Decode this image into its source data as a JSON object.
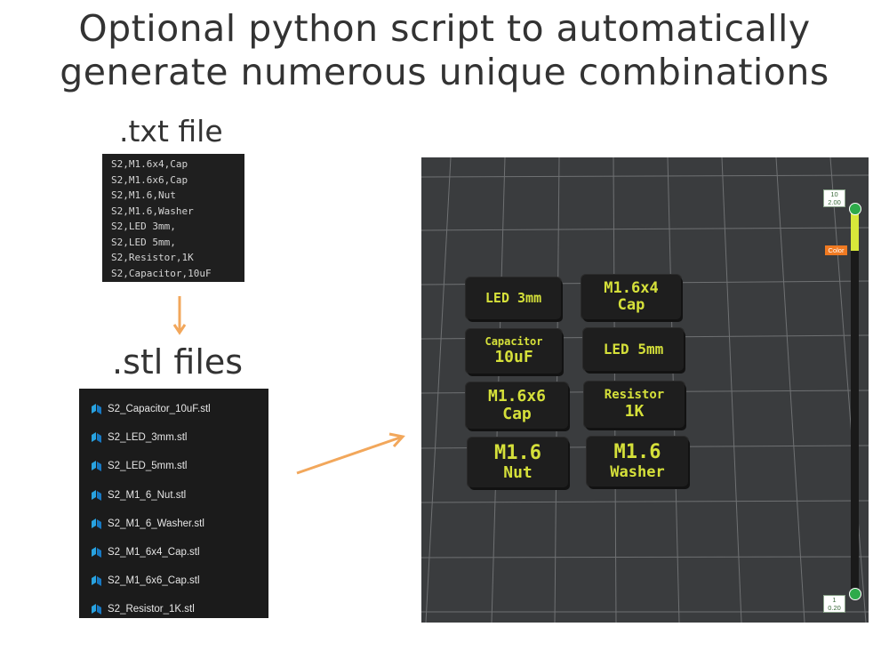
{
  "title": {
    "line1": "Optional python script to automatically",
    "line2": "generate numerous unique combinations"
  },
  "txt_section": {
    "heading": ".txt file",
    "lines": [
      "S2,M1.6x4,Cap",
      "S2,M1.6x6,Cap",
      "S2,M1.6,Nut",
      "S2,M1.6,Washer",
      "S2,LED 3mm,",
      "S2,LED 5mm,",
      "S2,Resistor,1K",
      "S2,Capacitor,10uF"
    ]
  },
  "stl_section": {
    "heading": ".stl files",
    "file_icon": "3d-model-file-icon",
    "files": [
      "S2_Capacitor_10uF.stl",
      "S2_LED_3mm.stl",
      "S2_LED_5mm.stl",
      "S2_M1_6_Nut.stl",
      "S2_M1_6_Washer.stl",
      "S2_M1_6x4_Cap.stl",
      "S2_M1_6x6_Cap.stl",
      "S2_Resistor_1K.stl"
    ]
  },
  "arrows": {
    "color": "#f2a75b"
  },
  "preview": {
    "labels": [
      {
        "line1": "LED 3mm",
        "line2": ""
      },
      {
        "line1": "M1.6x4",
        "line2": "Cap"
      },
      {
        "line1": "Capacitor",
        "line2": "10uF"
      },
      {
        "line1": "LED 5mm",
        "line2": ""
      },
      {
        "line1": "M1.6x6",
        "line2": "Cap"
      },
      {
        "line1": "Resistor",
        "line2": "1K"
      },
      {
        "line1": "M1.6",
        "line2": "Nut"
      },
      {
        "line1": "M1.6",
        "line2": "Washer"
      }
    ],
    "label_text_color": "#d5e03a",
    "plate_color": "#3a3c3e",
    "layer_slider": {
      "top_layer": "10",
      "top_height": "2.00",
      "bottom_layer": "1",
      "bottom_height": "0.20",
      "color_button": "Color"
    }
  }
}
